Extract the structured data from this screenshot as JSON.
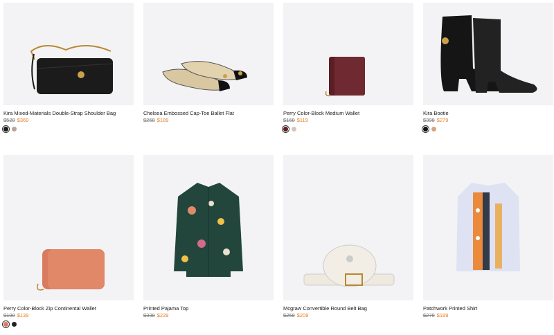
{
  "products": [
    {
      "name": "Kira Mixed-Materials Double-Strap Shoulder Bag",
      "old_price": "$528",
      "new_price": "$369",
      "swatches": [
        "#1a1a1a",
        "#b9a49a"
      ],
      "icon": "shoulder-bag"
    },
    {
      "name": "Chelsea Embossed Cap-Toe Ballet Flat",
      "old_price": "$268",
      "new_price": "$189",
      "swatches": [],
      "icon": "ballet-flat"
    },
    {
      "name": "Perry Color-Block Medium Wallet",
      "old_price": "$168",
      "new_price": "$119",
      "swatches": [
        "#5a1e24",
        "#d6c4bc"
      ],
      "icon": "wallet"
    },
    {
      "name": "Kira Bootie",
      "old_price": "$398",
      "new_price": "$279",
      "swatches": [
        "#111111",
        "#d6a57f"
      ],
      "icon": "bootie"
    },
    {
      "name": "Perry Color-Block Zip Continental Wallet",
      "old_price": "$198",
      "new_price": "$139",
      "swatches": [
        "#d97b5e",
        "#222222"
      ],
      "icon": "zip-wallet"
    },
    {
      "name": "Printed Pajama Top",
      "old_price": "$338",
      "new_price": "$239",
      "swatches": [],
      "icon": "pajama-top"
    },
    {
      "name": "Mcgraw Convertible Round Belt Bag",
      "old_price": "$258",
      "new_price": "$209",
      "swatches": [],
      "icon": "belt-bag"
    },
    {
      "name": "Patchwork Printed Shirt",
      "old_price": "$278",
      "new_price": "$189",
      "swatches": [],
      "icon": "shirt"
    }
  ]
}
